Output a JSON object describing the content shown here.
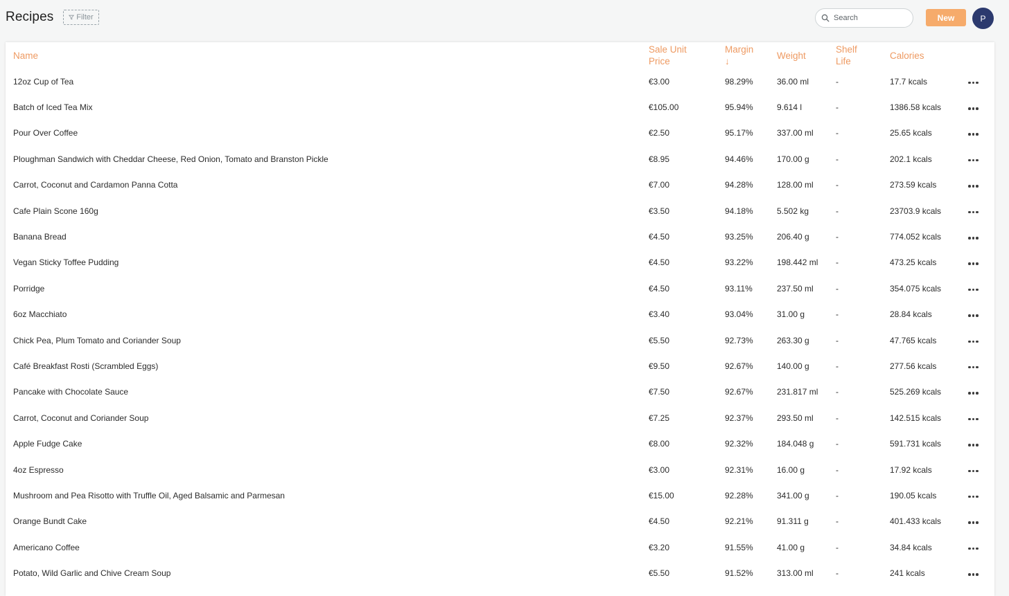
{
  "header": {
    "title": "Recipes",
    "filter_label": "Filter",
    "search_placeholder": "Search",
    "new_label": "New",
    "avatar_initial": "P"
  },
  "colors": {
    "accent": "#f6ab6b",
    "header_text": "#ee9a62",
    "avatar_bg": "#2c3a6e"
  },
  "table": {
    "columns": {
      "name": "Name",
      "price_line1": "Sale Unit",
      "price_line2": "Price",
      "margin_line1": "Margin",
      "margin_sort": "↓",
      "weight": "Weight",
      "shelf_line1": "Shelf",
      "shelf_line2": "Life",
      "calories": "Calories"
    },
    "rows": [
      {
        "name": "12oz Cup of Tea",
        "price": "€3.00",
        "margin": "98.29%",
        "weight": "36.00 ml",
        "shelf": "-",
        "calories": "17.7 kcals"
      },
      {
        "name": "Batch of Iced Tea Mix",
        "price": "€105.00",
        "margin": "95.94%",
        "weight": "9.614 l",
        "shelf": "-",
        "calories": "1386.58 kcals"
      },
      {
        "name": "Pour Over Coffee",
        "price": "€2.50",
        "margin": "95.17%",
        "weight": "337.00 ml",
        "shelf": "-",
        "calories": "25.65 kcals"
      },
      {
        "name": "Ploughman Sandwich with Cheddar Cheese, Red Onion, Tomato and Branston Pickle",
        "price": "€8.95",
        "margin": "94.46%",
        "weight": "170.00 g",
        "shelf": "-",
        "calories": "202.1 kcals"
      },
      {
        "name": "Carrot, Coconut and Cardamon Panna Cotta",
        "price": "€7.00",
        "margin": "94.28%",
        "weight": "128.00 ml",
        "shelf": "-",
        "calories": "273.59 kcals"
      },
      {
        "name": "Cafe Plain Scone 160g",
        "price": "€3.50",
        "margin": "94.18%",
        "weight": "5.502 kg",
        "shelf": "-",
        "calories": "23703.9 kcals"
      },
      {
        "name": "Banana Bread",
        "price": "€4.50",
        "margin": "93.25%",
        "weight": "206.40 g",
        "shelf": "-",
        "calories": "774.052 kcals"
      },
      {
        "name": "Vegan Sticky Toffee Pudding",
        "price": "€4.50",
        "margin": "93.22%",
        "weight": "198.442 ml",
        "shelf": "-",
        "calories": "473.25 kcals"
      },
      {
        "name": "Porridge",
        "price": "€4.50",
        "margin": "93.11%",
        "weight": "237.50 ml",
        "shelf": "-",
        "calories": "354.075 kcals"
      },
      {
        "name": "6oz Macchiato",
        "price": "€3.40",
        "margin": "93.04%",
        "weight": "31.00 g",
        "shelf": "-",
        "calories": "28.84 kcals"
      },
      {
        "name": "Chick Pea, Plum Tomato and Coriander Soup",
        "price": "€5.50",
        "margin": "92.73%",
        "weight": "263.30 g",
        "shelf": "-",
        "calories": "47.765 kcals"
      },
      {
        "name": "Café Breakfast Rosti (Scrambled Eggs)",
        "price": "€9.50",
        "margin": "92.67%",
        "weight": "140.00 g",
        "shelf": "-",
        "calories": "277.56 kcals"
      },
      {
        "name": "Pancake with Chocolate Sauce",
        "price": "€7.50",
        "margin": "92.67%",
        "weight": "231.817 ml",
        "shelf": "-",
        "calories": "525.269 kcals"
      },
      {
        "name": "Carrot, Coconut and Coriander Soup",
        "price": "€7.25",
        "margin": "92.37%",
        "weight": "293.50 ml",
        "shelf": "-",
        "calories": "142.515 kcals"
      },
      {
        "name": "Apple Fudge Cake",
        "price": "€8.00",
        "margin": "92.32%",
        "weight": "184.048 g",
        "shelf": "-",
        "calories": "591.731 kcals"
      },
      {
        "name": "4oz Espresso",
        "price": "€3.00",
        "margin": "92.31%",
        "weight": "16.00 g",
        "shelf": "-",
        "calories": "17.92 kcals"
      },
      {
        "name": "Mushroom and Pea Risotto with Truffle Oil, Aged Balsamic and Parmesan",
        "price": "€15.00",
        "margin": "92.28%",
        "weight": "341.00 g",
        "shelf": "-",
        "calories": "190.05 kcals"
      },
      {
        "name": "Orange Bundt Cake",
        "price": "€4.50",
        "margin": "92.21%",
        "weight": "91.311 g",
        "shelf": "-",
        "calories": "401.433 kcals"
      },
      {
        "name": "Americano Coffee",
        "price": "€3.20",
        "margin": "91.55%",
        "weight": "41.00 g",
        "shelf": "-",
        "calories": "34.84 kcals"
      },
      {
        "name": "Potato, Wild Garlic and Chive Cream Soup",
        "price": "€5.50",
        "margin": "91.52%",
        "weight": "313.00 ml",
        "shelf": "-",
        "calories": "241 kcals"
      }
    ]
  }
}
